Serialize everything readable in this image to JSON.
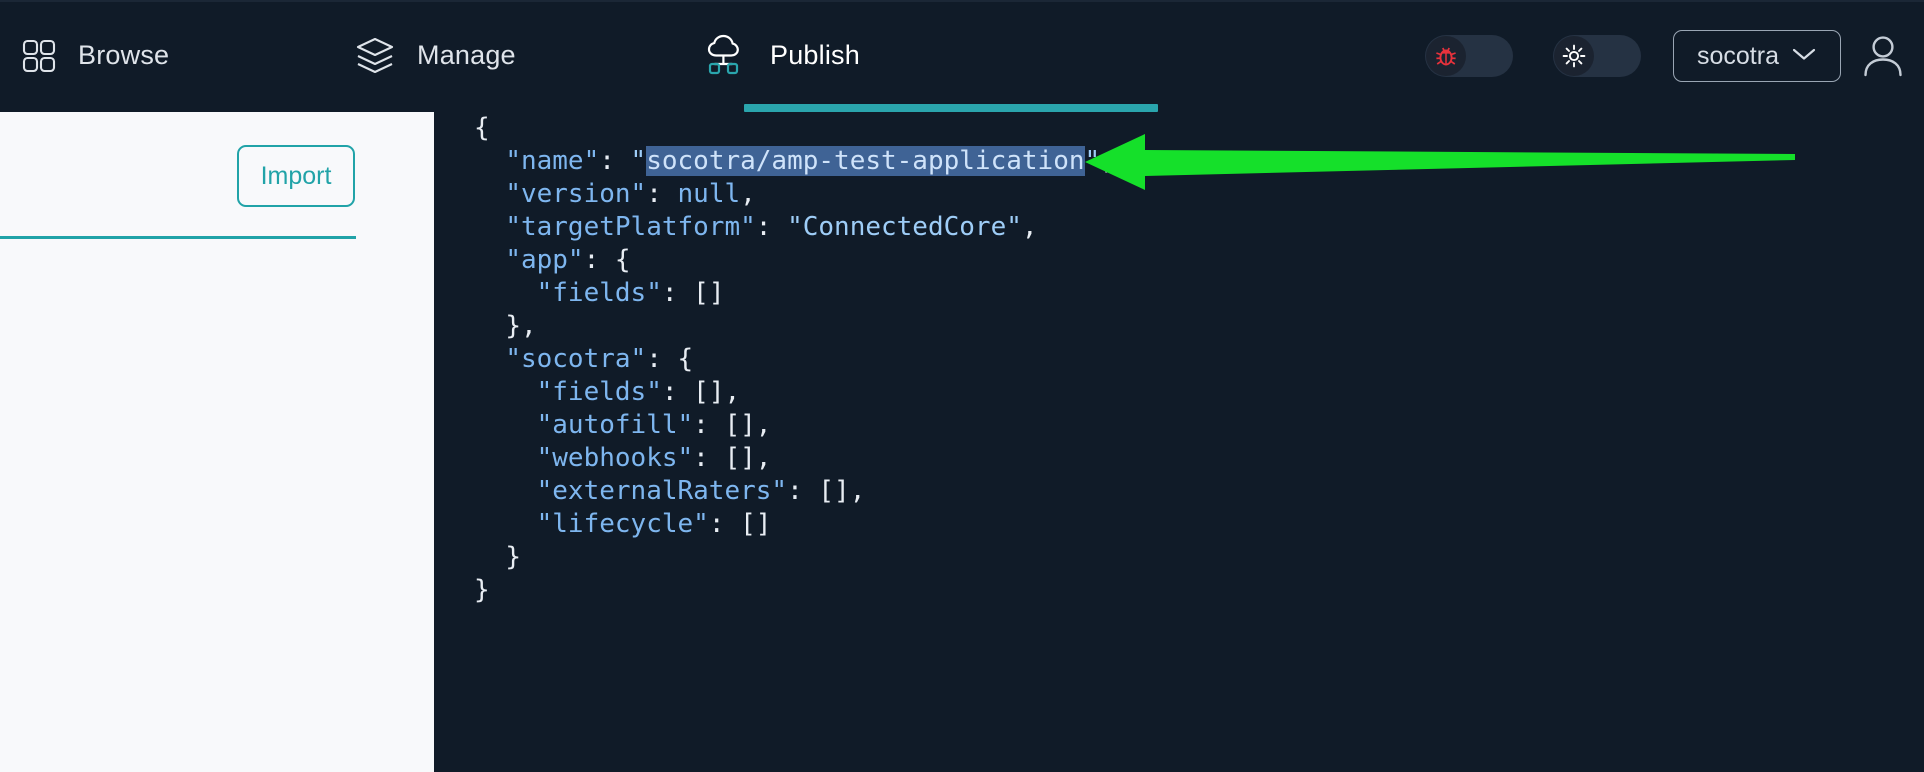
{
  "app": {
    "background_color": "#0e1824",
    "accent_color": "#2aa5ad",
    "panel_color": "#f8f9fb"
  },
  "topbar": {
    "nav": [
      {
        "id": "browse",
        "label": "Browse",
        "icon": "grid-icon",
        "active": false
      },
      {
        "id": "manage",
        "label": "Manage",
        "icon": "layers-icon",
        "active": false
      },
      {
        "id": "publish",
        "label": "Publish",
        "icon": "cloud-network-icon",
        "active": true
      }
    ],
    "toggles": [
      {
        "id": "debug",
        "icon": "bug-icon",
        "state": "off",
        "icon_color": "#e8323c"
      },
      {
        "id": "theme",
        "icon": "sun-icon",
        "state": "off",
        "icon_color": "#ffffff"
      }
    ],
    "org_select": {
      "label": "socotra",
      "icon": "chevron-down-icon"
    },
    "avatar": {
      "icon": "user-avatar-icon"
    }
  },
  "left_panel": {
    "import_button": {
      "label": "Import",
      "color": "#21a3a8"
    },
    "divider_color": "#21a3a8"
  },
  "code_pane": {
    "language": "json",
    "selection": {
      "text": "socotra/amp-test-application",
      "highlight_color": "#3f6395"
    },
    "lines": [
      {
        "indent": 0,
        "parts": [
          {
            "t": "{",
            "c": "p"
          }
        ]
      },
      {
        "indent": 1,
        "parts": [
          {
            "t": "\"name\"",
            "c": "k"
          },
          {
            "t": ": ",
            "c": "p"
          },
          {
            "t": "\"",
            "c": "s"
          },
          {
            "t": "socotra/amp-test-application",
            "c": "sel"
          },
          {
            "t": "\"",
            "c": "s"
          },
          {
            "t": ",",
            "c": "p"
          }
        ]
      },
      {
        "indent": 1,
        "parts": [
          {
            "t": "\"version\"",
            "c": "k"
          },
          {
            "t": ": ",
            "c": "p"
          },
          {
            "t": "null",
            "c": "nul"
          },
          {
            "t": ",",
            "c": "p"
          }
        ]
      },
      {
        "indent": 1,
        "parts": [
          {
            "t": "\"targetPlatform\"",
            "c": "k"
          },
          {
            "t": ": ",
            "c": "p"
          },
          {
            "t": "\"ConnectedCore\"",
            "c": "s"
          },
          {
            "t": ",",
            "c": "p"
          }
        ]
      },
      {
        "indent": 1,
        "parts": [
          {
            "t": "\"app\"",
            "c": "k"
          },
          {
            "t": ": {",
            "c": "p"
          }
        ]
      },
      {
        "indent": 2,
        "parts": [
          {
            "t": "\"fields\"",
            "c": "k"
          },
          {
            "t": ": []",
            "c": "p"
          }
        ]
      },
      {
        "indent": 1,
        "parts": [
          {
            "t": "},",
            "c": "p"
          }
        ]
      },
      {
        "indent": 1,
        "parts": [
          {
            "t": "\"socotra\"",
            "c": "k"
          },
          {
            "t": ": {",
            "c": "p"
          }
        ]
      },
      {
        "indent": 2,
        "parts": [
          {
            "t": "\"fields\"",
            "c": "k"
          },
          {
            "t": ": [],",
            "c": "p"
          }
        ]
      },
      {
        "indent": 2,
        "parts": [
          {
            "t": "\"autofill\"",
            "c": "k"
          },
          {
            "t": ": [],",
            "c": "p"
          }
        ]
      },
      {
        "indent": 2,
        "parts": [
          {
            "t": "\"webhooks\"",
            "c": "k"
          },
          {
            "t": ": [],",
            "c": "p"
          }
        ]
      },
      {
        "indent": 2,
        "parts": [
          {
            "t": "\"externalRaters\"",
            "c": "k"
          },
          {
            "t": ": [],",
            "c": "p"
          }
        ]
      },
      {
        "indent": 2,
        "parts": [
          {
            "t": "\"lifecycle\"",
            "c": "k"
          },
          {
            "t": ": []",
            "c": "p"
          }
        ]
      },
      {
        "indent": 1,
        "parts": [
          {
            "t": "}",
            "c": "p"
          }
        ]
      },
      {
        "indent": 0,
        "parts": [
          {
            "t": "}",
            "c": "p"
          }
        ]
      }
    ]
  },
  "annotation": {
    "arrow": {
      "direction": "left",
      "color": "#15e02a",
      "points_at": "name-value-selection"
    }
  }
}
